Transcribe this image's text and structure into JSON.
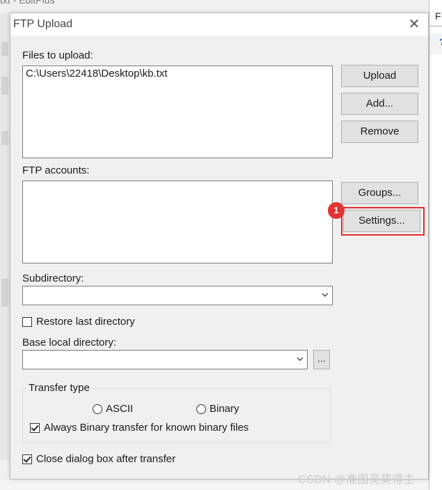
{
  "background": {
    "title_fragment": "txt - EditPlus",
    "right_window_fragment": "F",
    "right_icon": "help-icon"
  },
  "dialog": {
    "title": "FTP Upload",
    "close_glyph": "✕",
    "files_label": "Files to upload:",
    "files": [
      "C:\\Users\\22418\\Desktop\\kb.txt"
    ],
    "buttons": {
      "upload": "Upload",
      "add": "Add...",
      "remove": "Remove",
      "groups": "Groups...",
      "settings": "Settings..."
    },
    "ftp_accounts_label": "FTP accounts:",
    "ftp_accounts": [],
    "subdirectory_label": "Subdirectory:",
    "subdirectory_value": "",
    "restore_last_directory": {
      "label": "Restore last directory",
      "checked": false
    },
    "base_local_directory_label": "Base local directory:",
    "base_local_directory_value": "",
    "browse_label": "...",
    "transfer_type": {
      "title": "Transfer type",
      "ascii_label": "ASCII",
      "binary_label": "Binary",
      "always_binary": {
        "label": "Always Binary transfer for known binary files",
        "checked": true
      }
    },
    "close_after_transfer": {
      "label": "Close dialog box after transfer",
      "checked": true
    }
  },
  "annotation": {
    "badge_number": "1",
    "highlight_color": "#e12b2b"
  },
  "watermark": "CSDN @准图灵奖得主"
}
